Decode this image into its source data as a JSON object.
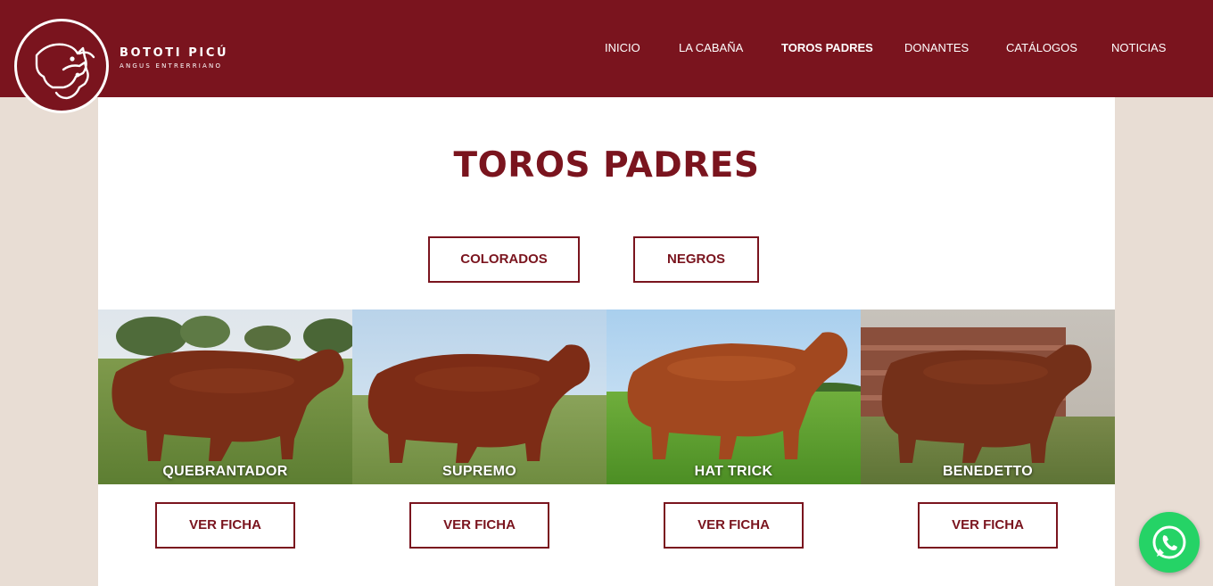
{
  "brand": {
    "name": "BOTOTI PICÚ",
    "subtitle": "ANGUS ENTRERRIANO"
  },
  "nav": {
    "items": [
      {
        "label": "INICIO"
      },
      {
        "label": "LA CABAÑA"
      },
      {
        "label": "TOROS PADRES",
        "active": true
      },
      {
        "label": "DONANTES"
      },
      {
        "label": "CATÁLOGOS"
      },
      {
        "label": "NOTICIAS"
      }
    ]
  },
  "page": {
    "title": "TOROS PADRES"
  },
  "filters": [
    {
      "label": "COLORADOS"
    },
    {
      "label": "NEGROS"
    }
  ],
  "bulls": [
    {
      "name": "QUEBRANTADOR",
      "button": "VER FICHA"
    },
    {
      "name": "SUPREMO",
      "button": "VER FICHA"
    },
    {
      "name": "HAT TRICK",
      "button": "VER FICHA"
    },
    {
      "name": "BENEDETTO",
      "button": "VER FICHA"
    }
  ],
  "colors": {
    "primary": "#7a141e",
    "background": "#e8ddd4",
    "whatsapp": "#25d366"
  },
  "icons": {
    "logo": "sheep-logo-icon",
    "whatsapp": "whatsapp-icon"
  }
}
